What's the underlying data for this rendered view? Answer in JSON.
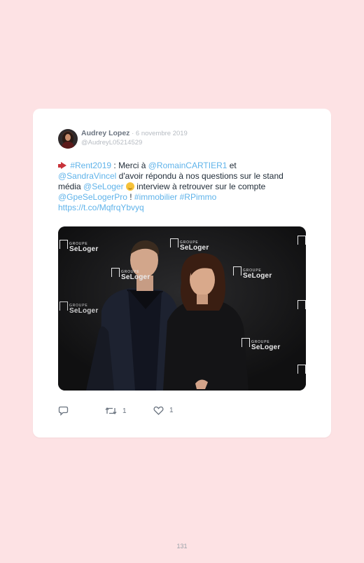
{
  "tweet": {
    "author_name": "Audrey Lopez",
    "separator": " · ",
    "date": "6 novembre 2019",
    "handle": "@AudreyL05214529",
    "text_parts": [
      {
        "t": "#Rent2019",
        "link": true
      },
      {
        "t": " : Merci à ",
        "link": false
      },
      {
        "t": "@RomainCARTIER1",
        "link": true
      },
      {
        "t": " et ",
        "link": false
      },
      {
        "t": "@SandraVincel",
        "link": true
      },
      {
        "t": " d'avoir répondu à nos questions sur le stand média ",
        "link": false
      },
      {
        "t": "@SeLoger",
        "link": true
      },
      {
        "t": " interview à retrouver sur le compte ",
        "link": false
      },
      {
        "t": "@GpeSeLogerPro",
        "link": true
      },
      {
        "t": " ! ",
        "link": false
      },
      {
        "t": "#immobilier",
        "link": true
      },
      {
        "t": " ",
        "link": false
      },
      {
        "t": "#RPimmo",
        "link": true
      },
      {
        "t": " ",
        "link": false
      },
      {
        "t": "https://t.co/MqfrqYbvyq",
        "link": true
      }
    ],
    "media_logo": {
      "group": "GROUPE",
      "brand": "SeLoger"
    },
    "reply_count": "",
    "retweet_count": "1",
    "like_count": "1"
  },
  "colors": {
    "page_background": "#fde2e4",
    "card_background": "#ffffff",
    "link": "#5fb3ea",
    "text": "#1e2a36",
    "meta": "#b6bbc2"
  },
  "icons": [
    "megaphone-emoji",
    "winking-face-emoji",
    "reply-icon",
    "retweet-icon",
    "like-icon"
  ],
  "page_number": "131"
}
